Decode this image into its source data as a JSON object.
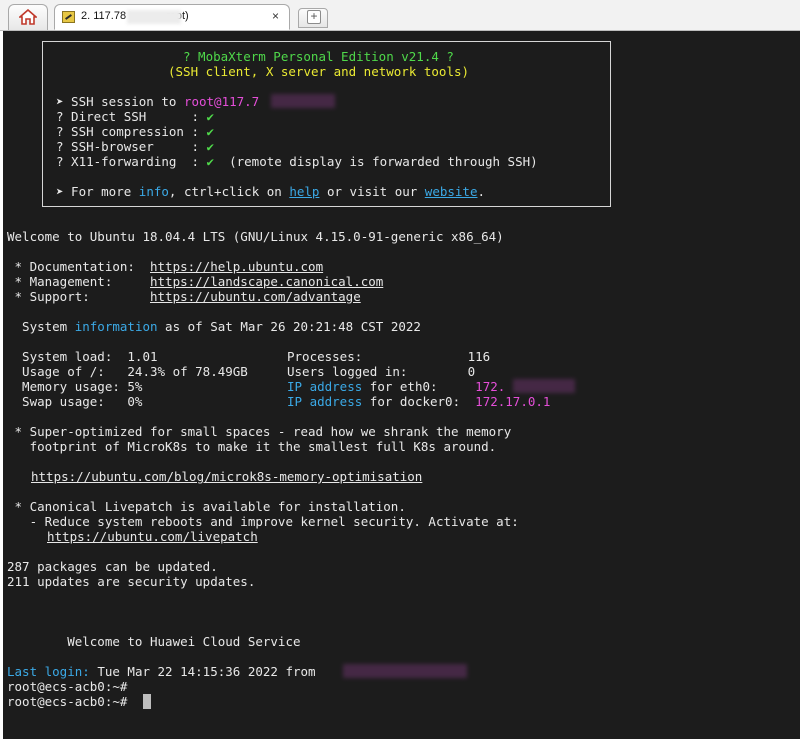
{
  "tabs": {
    "home_icon": "home-icon",
    "session": {
      "label": "2. 117.78",
      "label_suffix": "root)",
      "icon": "terminal-icon",
      "close": "×"
    },
    "new_tab_icon": "plus-icon",
    "new_tab_symbol": "+"
  },
  "banner": {
    "title": "? MobaXterm Personal Edition v21.4 ?",
    "subtitle": "(SSH client, X server and network tools)",
    "session_prefix": "➤ SSH session to ",
    "session_target": "root@117.7",
    "items": [
      {
        "label": "? Direct SSH      : ",
        "check": "✔"
      },
      {
        "label": "? SSH compression : ",
        "check": "✔"
      },
      {
        "label": "? SSH-browser     : ",
        "check": "✔"
      },
      {
        "label": "? X11-forwarding  : ",
        "check": "✔",
        "note": "  (remote display is forwarded through SSH)"
      }
    ],
    "more_prefix": "➤ For more ",
    "more_info": "info",
    "more_mid": ", ctrl+click on ",
    "more_help": "help",
    "more_mid2": " or visit our ",
    "more_website": "website",
    "more_end": "."
  },
  "motd": {
    "welcome": "Welcome to Ubuntu 18.04.4 LTS (GNU/Linux 4.15.0-91-generic x86_64)",
    "links": [
      {
        "label": " * Documentation:  ",
        "url": "https://help.ubuntu.com"
      },
      {
        "label": " * Management:     ",
        "url": "https://landscape.canonical.com"
      },
      {
        "label": " * Support:        ",
        "url": "https://ubuntu.com/advantage"
      }
    ],
    "sysinfo_prefix": "  System ",
    "sysinfo_word": "information",
    "sysinfo_suffix": " as of Sat Mar 26 20:21:48 CST 2022",
    "stats_left": [
      "  System load:  1.01",
      "  Usage of /:   24.3% of 78.49GB",
      "  Memory usage: 5%",
      "  Swap usage:   0%"
    ],
    "stats_right": [
      {
        "pre": "",
        "key": "Processes:",
        "rest": "              ",
        "value": "116"
      },
      {
        "pre": "",
        "key": "Users logged in:",
        "rest": "        ",
        "value": "0"
      },
      {
        "pre": "IP address",
        "key": " for eth0:",
        "rest": "     ",
        "value": "172."
      },
      {
        "pre": "IP address",
        "key": " for docker0:",
        "rest": "  ",
        "value": "172.17.0.1"
      }
    ],
    "microk8s_1": " * Super-optimized for small spaces - read how we shrank the memory",
    "microk8s_2": "   footprint of MicroK8s to make it the smallest full K8s around.",
    "microk8s_link": "https://ubuntu.com/blog/microk8s-memory-optimisation",
    "livepatch_1": " * Canonical Livepatch is available for installation.",
    "livepatch_2": "   - Reduce system reboots and improve kernel security. Activate at:",
    "livepatch_link": "https://ubuntu.com/livepatch",
    "updates_1": "287 packages can be updated.",
    "updates_2": "211 updates are security updates.",
    "huawei": "        Welcome to Huawei Cloud Service",
    "last_login_label": "Last login:",
    "last_login_value": " Tue Mar 22 14:15:36 2022 from ",
    "prompt_1": "root@ecs-acb0:~#",
    "prompt_2": "root@ecs-acb0:~# "
  },
  "colors": {
    "terminal_bg": "#1c1c1c",
    "text": "#e8e8e8",
    "cyan": "#3ba9e6",
    "magenta": "#e44ed8",
    "green": "#4fd84a",
    "yellow": "#eaea33"
  }
}
